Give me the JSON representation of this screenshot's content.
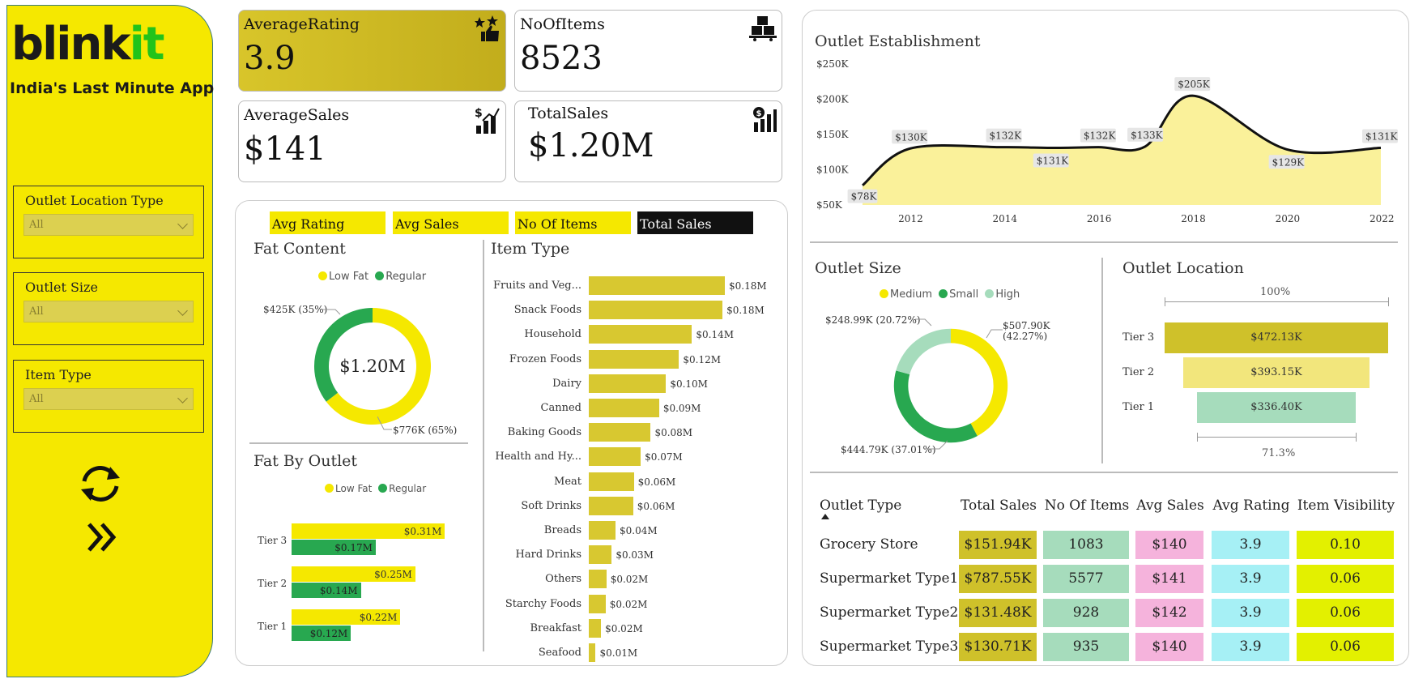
{
  "sidebar": {
    "logo_part1": "blink",
    "logo_part2": "it",
    "tagline": "India's Last Minute App",
    "filters": [
      {
        "label": "Outlet Location Type",
        "value": "All"
      },
      {
        "label": "Outlet Size",
        "value": "All"
      },
      {
        "label": "Item Type",
        "value": "All"
      }
    ],
    "icons": [
      "refresh-icon",
      "double-chevron-right-icon"
    ]
  },
  "kpis": [
    {
      "title": "AverageRating",
      "value": "3.9",
      "icon": "rating-stars-thumb-icon"
    },
    {
      "title": "NoOfItems",
      "value": "8523",
      "icon": "boxes-cart-icon"
    },
    {
      "title": "AverageSales",
      "value": "$141",
      "icon": "dollar-growth-bars-icon"
    },
    {
      "title": "TotalSales",
      "value": "$1.20M",
      "icon": "dollar-bar-chart-icon"
    }
  ],
  "metric_tabs": [
    {
      "label": "Avg Rating",
      "active": false
    },
    {
      "label": "Avg Sales",
      "active": false
    },
    {
      "label": "No Of Items",
      "active": false
    },
    {
      "label": "Total Sales",
      "active": true
    }
  ],
  "colors": {
    "yellow": "#f5e800",
    "green": "#28a850",
    "light_green": "#a6dcbc",
    "olive": "#cfc12a",
    "pink": "#f5b3dc",
    "cyan": "#a6f0f5",
    "lime": "#e3f000"
  },
  "fat_content": {
    "title": "Fat Content",
    "legend": [
      "Low Fat",
      "Regular"
    ],
    "center_label": "$1.20M",
    "labels": {
      "regular": "$425K (35%)",
      "low_fat": "$776K (65%)"
    },
    "chart_data": {
      "type": "pie",
      "categories": [
        "Low Fat",
        "Regular"
      ],
      "values": [
        776,
        425
      ],
      "percent": [
        65,
        35
      ]
    }
  },
  "fat_by_outlet": {
    "title": "Fat By Outlet",
    "legend": [
      "Low Fat",
      "Regular"
    ],
    "chart_data": {
      "type": "bar",
      "categories": [
        "Tier 3",
        "Tier 2",
        "Tier 1"
      ],
      "series": [
        {
          "name": "Low Fat",
          "values": [
            0.31,
            0.25,
            0.22
          ],
          "labels": [
            "$0.31M",
            "$0.25M",
            "$0.22M"
          ]
        },
        {
          "name": "Regular",
          "values": [
            0.17,
            0.14,
            0.12
          ],
          "labels": [
            "$0.17M",
            "$0.14M",
            "$0.12M"
          ]
        }
      ]
    }
  },
  "item_type": {
    "title": "Item Type",
    "chart_data": {
      "type": "bar",
      "categories": [
        "Fruits and Veg...",
        "Snack Foods",
        "Household",
        "Frozen Foods",
        "Dairy",
        "Canned",
        "Baking Goods",
        "Health and Hy...",
        "Meat",
        "Soft Drinks",
        "Breads",
        "Hard Drinks",
        "Others",
        "Starchy Foods",
        "Breakfast",
        "Seafood"
      ],
      "values": [
        0.178,
        0.175,
        0.135,
        0.118,
        0.101,
        0.092,
        0.081,
        0.068,
        0.059,
        0.058,
        0.035,
        0.03,
        0.023,
        0.022,
        0.016,
        0.009
      ],
      "labels": [
        "$0.18M",
        "$0.18M",
        "$0.14M",
        "$0.12M",
        "$0.10M",
        "$0.09M",
        "$0.08M",
        "$0.07M",
        "$0.06M",
        "$0.06M",
        "$0.04M",
        "$0.03M",
        "$0.02M",
        "$0.02M",
        "$0.02M",
        "$0.01M"
      ]
    }
  },
  "outlet_establishment": {
    "title": "Outlet Establishment",
    "chart_data": {
      "type": "area",
      "x": [
        2011,
        2012,
        2014,
        2015,
        2016,
        2017,
        2018,
        2020,
        2022
      ],
      "values": [
        78,
        130,
        132,
        131,
        132,
        133,
        205,
        129,
        131
      ],
      "labels": [
        "$78K",
        "$130K",
        "$132K",
        "$131K",
        "$132K",
        "$133K",
        "$205K",
        "$129K",
        "$131K"
      ],
      "x_ticks": [
        "2012",
        "2014",
        "2016",
        "2018",
        "2020",
        "2022"
      ],
      "y_ticks": [
        "$250K",
        "$200K",
        "$150K",
        "$100K",
        "$50K"
      ],
      "ylim": [
        50,
        250
      ]
    }
  },
  "outlet_size": {
    "title": "Outlet Size",
    "legend": [
      "Medium",
      "Small",
      "High"
    ],
    "labels": {
      "medium": "$507.90K\n(42.27%)",
      "small": "$444.79K (37.01%)",
      "high": "$248.99K (20.72%)"
    },
    "chart_data": {
      "type": "pie",
      "categories": [
        "Medium",
        "Small",
        "High"
      ],
      "values": [
        507.9,
        444.79,
        248.99
      ],
      "percent": [
        42.27,
        37.01,
        20.72
      ]
    }
  },
  "outlet_location": {
    "title": "Outlet Location",
    "top_pct": "100%",
    "bottom_pct": "71.3%",
    "chart_data": {
      "type": "bar",
      "categories": [
        "Tier 3",
        "Tier 2",
        "Tier 1"
      ],
      "values": [
        472.13,
        393.15,
        336.4
      ],
      "labels": [
        "$472.13K",
        "$393.15K",
        "$336.40K"
      ]
    }
  },
  "outlet_table": {
    "headers": [
      "Outlet Type",
      "Total Sales",
      "No Of Items",
      "Avg Sales",
      "Avg Rating",
      "Item Visibility"
    ],
    "rows": [
      {
        "name": "Grocery Store",
        "total_sales": "$151.94K",
        "items": "1083",
        "avg_sales": "$140",
        "avg_rating": "3.9",
        "visibility": "0.10"
      },
      {
        "name": "Supermarket Type1",
        "total_sales": "$787.55K",
        "items": "5577",
        "avg_sales": "$141",
        "avg_rating": "3.9",
        "visibility": "0.06"
      },
      {
        "name": "Supermarket Type2",
        "total_sales": "$131.48K",
        "items": "928",
        "avg_sales": "$142",
        "avg_rating": "3.9",
        "visibility": "0.06"
      },
      {
        "name": "Supermarket Type3",
        "total_sales": "$130.71K",
        "items": "935",
        "avg_sales": "$140",
        "avg_rating": "3.9",
        "visibility": "0.06"
      }
    ]
  }
}
